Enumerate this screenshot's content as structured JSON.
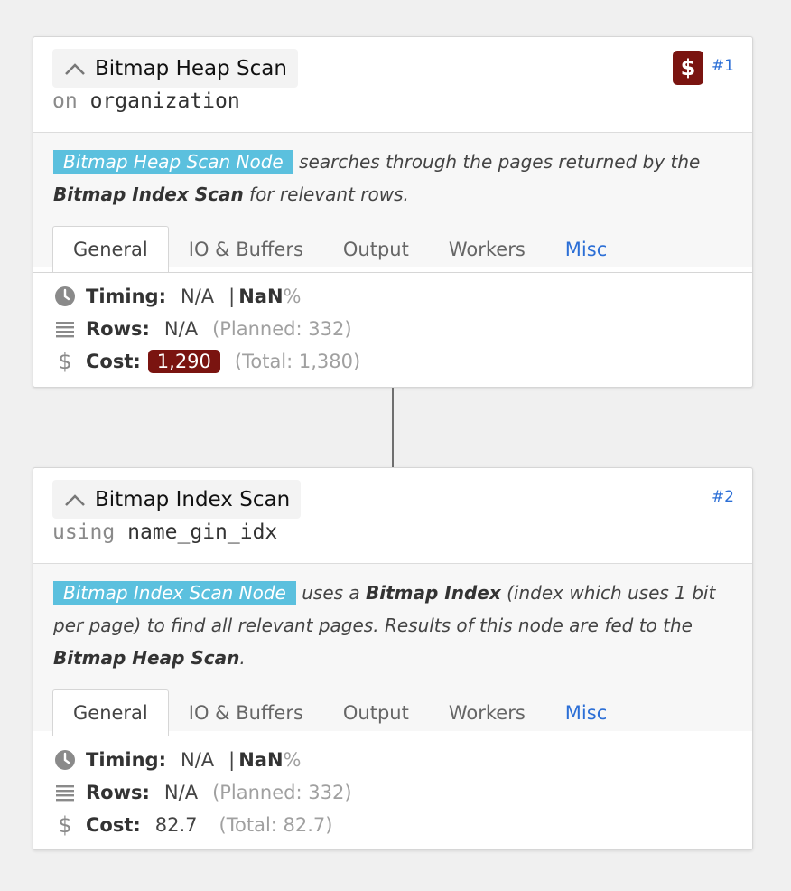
{
  "nodes": [
    {
      "title": "Bitmap Heap Scan",
      "sub_keyword": "on",
      "sub_object": "organization",
      "id_label": "#1",
      "cost_badge": "$",
      "description": {
        "tag": "Bitmap Heap Scan Node",
        "text1": " searches through the pages returned by the ",
        "bold1": "Bitmap Index Scan",
        "text2": " for relevant rows."
      },
      "tabs": [
        "General",
        "IO & Buffers",
        "Output",
        "Workers",
        "Misc"
      ],
      "stats": {
        "timing_label": "Timing:",
        "timing_value": "N/A",
        "timing_sep": "|",
        "timing_nan": "NaN",
        "timing_pct": "%",
        "rows_label": "Rows:",
        "rows_value": "N/A",
        "rows_planned": "(Planned: 332)",
        "cost_label": "Cost:",
        "cost_value": "1,290",
        "cost_total": "(Total: 1,380)"
      }
    },
    {
      "title": "Bitmap Index Scan",
      "sub_keyword": "using",
      "sub_object": "name_gin_idx",
      "id_label": "#2",
      "description": {
        "tag": "Bitmap Index Scan Node",
        "text1": " uses a ",
        "bold1": "Bitmap Index",
        "text2": " (index which uses 1 bit per page) to find all relevant pages. Results of this node are fed to the ",
        "bold2": "Bitmap Heap Scan",
        "text3": "."
      },
      "tabs": [
        "General",
        "IO & Buffers",
        "Output",
        "Workers",
        "Misc"
      ],
      "stats": {
        "timing_label": "Timing:",
        "timing_value": "N/A",
        "timing_sep": "|",
        "timing_nan": "NaN",
        "timing_pct": "%",
        "rows_label": "Rows:",
        "rows_value": "N/A",
        "rows_planned": "(Planned: 332)",
        "cost_label": "Cost:",
        "cost_value": "82.7",
        "cost_total": "(Total: 82.7)"
      }
    }
  ],
  "colors": {
    "accent_blue": "#2c6fd6",
    "node_tag": "#5bc0de",
    "cost_highlight": "#7a1410"
  },
  "icons": {
    "collapse": "chevron-up-icon",
    "timing": "clock-icon",
    "rows": "list-lines-icon",
    "cost": "dollar-icon"
  }
}
